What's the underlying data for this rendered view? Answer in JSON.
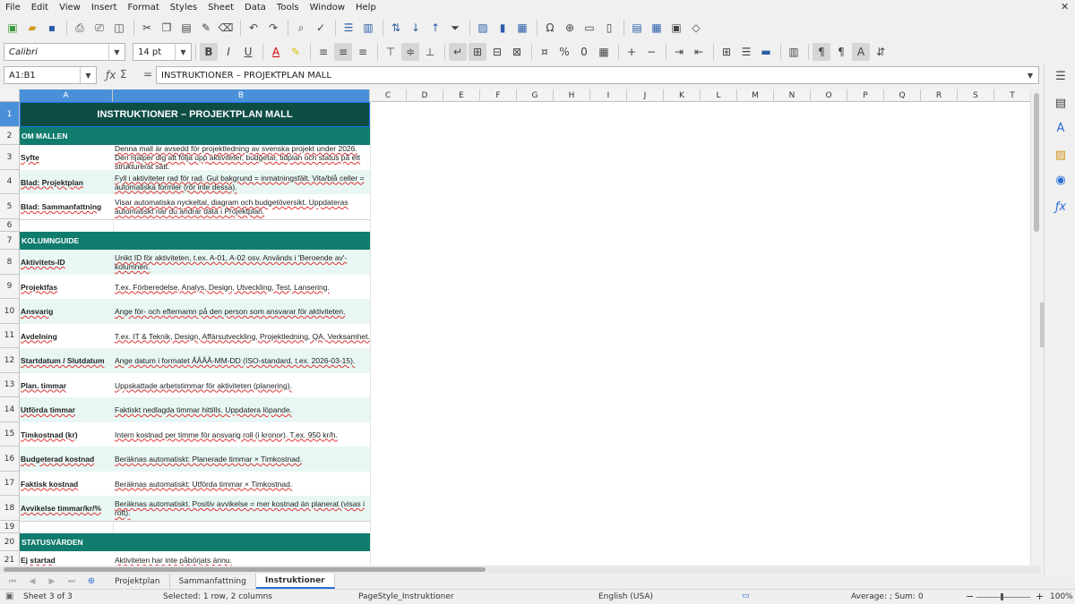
{
  "menu": [
    "File",
    "Edit",
    "View",
    "Insert",
    "Format",
    "Styles",
    "Sheet",
    "Data",
    "Tools",
    "Window",
    "Help"
  ],
  "font": {
    "name": "Calibri",
    "size": "14 pt"
  },
  "namebox": "A1:B1",
  "formula": "INSTRUKTIONER – PROJEKTPLAN MALL",
  "columns": [
    "A",
    "B",
    "C",
    "D",
    "E",
    "F",
    "G",
    "H",
    "I",
    "J",
    "K",
    "L",
    "M",
    "N",
    "O",
    "P",
    "Q",
    "R",
    "S",
    "T"
  ],
  "title": "INSTRUKTIONER – PROJEKTPLAN MALL",
  "sections": {
    "om": "OM MALLEN",
    "kolumn": "KOLUMNGUIDE",
    "status": "STATUSVÄRDEN"
  },
  "rows": [
    {
      "n": "3",
      "a": "Syfte",
      "b": "Denna mall är avsedd för projektledning av svenska projekt under 2026. Den hjälper dig att följa upp aktiviteter, budgetar, tidplan och status på ett strukturerat sätt."
    },
    {
      "n": "4",
      "a": "Blad: Projektplan",
      "b": "Fyll i aktiviteter rad för rad. Gul bakgrund = inmatningsfält. Vita/blå celler = automatiska formler (rör inte dessa)."
    },
    {
      "n": "5",
      "a": "Blad: Sammanfattning",
      "b": "Visar automatiska nyckeltal, diagram och budgetöversikt. Uppdateras automatiskt när du ändrar data i Projektplan."
    },
    {
      "n": "8",
      "a": "Aktivitets-ID",
      "b": "Unikt ID för aktiviteten, t.ex. A-01, A-02 osv. Används i 'Beroende av'-kolumnen."
    },
    {
      "n": "9",
      "a": "Projektfas",
      "b": "T.ex. Förberedelse, Analys, Design, Utveckling, Test, Lansering."
    },
    {
      "n": "10",
      "a": "Ansvarig",
      "b": "Ange för- och efternamn på den person som ansvarar för aktiviteten."
    },
    {
      "n": "11",
      "a": "Avdelning",
      "b": "T.ex. IT & Teknik, Design, Affärsutveckling, Projektledning, QA, Verksamhet."
    },
    {
      "n": "12",
      "a": "Startdatum / Slutdatum",
      "b": "Ange datum i formatet ÅÅÅÅ-MM-DD (ISO-standard, t.ex. 2026-03-15)."
    },
    {
      "n": "13",
      "a": "Plan. timmar",
      "b": "Uppskattade arbetstimmar för aktiviteten (planering)."
    },
    {
      "n": "14",
      "a": "Utförda timmar",
      "b": "Faktiskt nedlagda timmar hittills. Uppdatera löpande."
    },
    {
      "n": "15",
      "a": "Timkostnad (kr)",
      "b": "Intern kostnad per timme för ansvarig roll (i kronor). T.ex. 950 kr/h."
    },
    {
      "n": "16",
      "a": "Budgeterad kostnad",
      "b": "Beräknas automatiskt: Planerade timmar × Timkostnad."
    },
    {
      "n": "17",
      "a": "Faktisk kostnad",
      "b": "Beräknas automatiskt: Utförda timmar × Timkostnad."
    },
    {
      "n": "18",
      "a": "Avvikelse timmar/kr/%",
      "b": "Beräknas automatiskt. Positiv avvikelse = mer kostnad än planerat (visas i rött)."
    },
    {
      "n": "21",
      "a": "Ej startad",
      "b": "Aktiviteten har inte påbörjats ännu."
    }
  ],
  "rownums": {
    "r1": "1",
    "r2": "2",
    "r6": "6",
    "r7": "7",
    "r19": "19",
    "r20": "20"
  },
  "tabs": [
    "Projektplan",
    "Sammanfattning",
    "Instruktioner"
  ],
  "status": {
    "sheet": "Sheet 3 of 3",
    "selection": "Selected: 1 row, 2 columns",
    "pagestyle": "PageStyle_Instruktioner",
    "lang": "English (USA)",
    "sum": "Average: ; Sum: 0",
    "zoom": "100%"
  }
}
